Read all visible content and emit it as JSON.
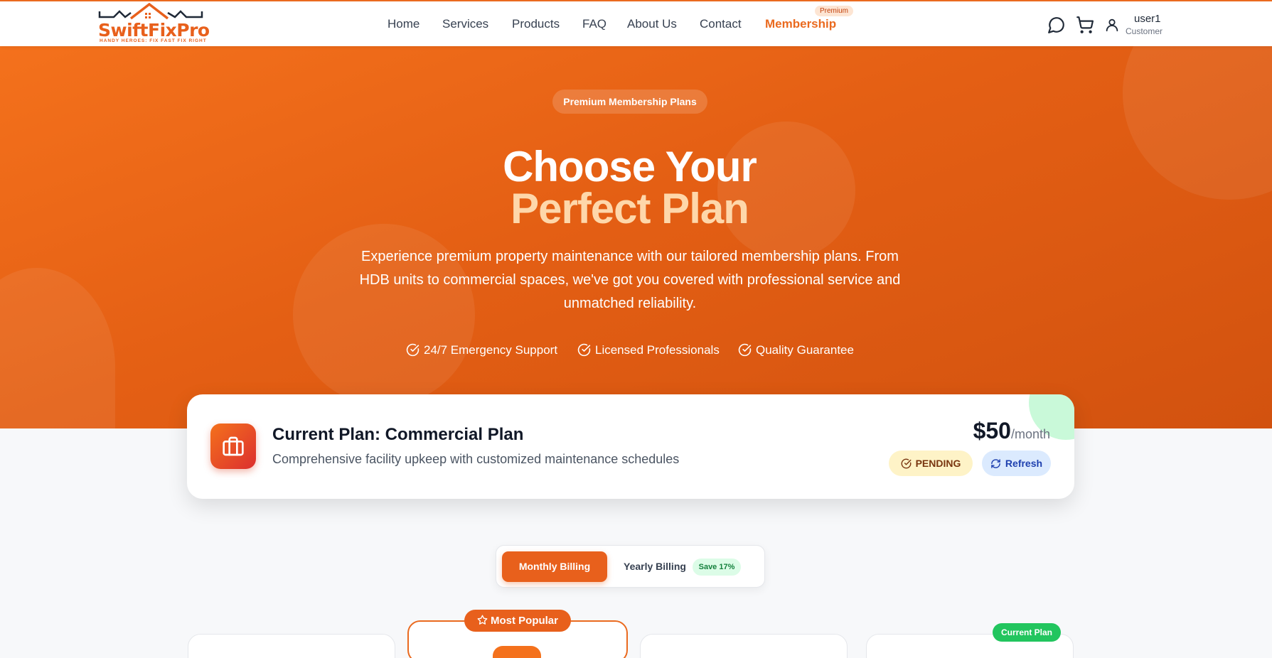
{
  "brand": {
    "name": "SwiftFixPro",
    "tagline": "HANDY HEROES: FIX FAST FIX RIGHT",
    "color": "#e8601c"
  },
  "nav": {
    "links": [
      {
        "label": "Home"
      },
      {
        "label": "Services"
      },
      {
        "label": "Products"
      },
      {
        "label": "FAQ"
      },
      {
        "label": "About Us"
      },
      {
        "label": "Contact"
      },
      {
        "label": "Membership",
        "active": true
      }
    ],
    "premium_badge": "Premium",
    "icons": [
      "chat-icon",
      "cart-icon",
      "user-icon"
    ],
    "user": {
      "name": "user1",
      "role": "Customer"
    }
  },
  "hero": {
    "pill": "Premium Membership Plans",
    "title_line1": "Choose Your",
    "title_line2": "Perfect Plan",
    "description": "Experience premium property maintenance with our tailored membership plans. From HDB units to commercial spaces, we've got you covered with professional service and unmatched reliability.",
    "features": [
      "24/7 Emergency Support",
      "Licensed Professionals",
      "Quality Guarantee"
    ]
  },
  "current_plan": {
    "title": "Current Plan: Commercial Plan",
    "description": "Comprehensive facility upkeep with customized maintenance schedules",
    "price": "$50",
    "period": "/month",
    "status": "PENDING",
    "refresh_label": "Refresh",
    "icon": "briefcase-icon"
  },
  "billing": {
    "monthly_label": "Monthly Billing",
    "yearly_label": "Yearly Billing",
    "save_label": "Save 17%",
    "selected": "monthly"
  },
  "plans": {
    "popular_label": "Most Popular",
    "current_label": "Current Plan"
  },
  "colors": {
    "accent": "#e8601c",
    "hero_light_text": "#fed7aa",
    "success": "#22c55e"
  }
}
